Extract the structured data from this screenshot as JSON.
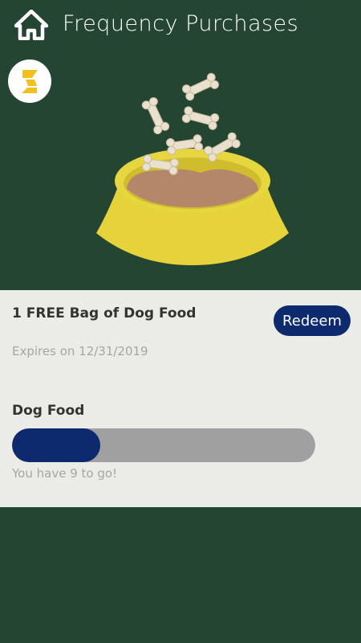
{
  "header": {
    "title": "Frequency Purchases",
    "home_icon": "home-icon"
  },
  "brand": {
    "logo_icon": "brand-logo-icon"
  },
  "hero": {
    "illustration": "dog-bowl-with-bones"
  },
  "reward": {
    "title": "1 FREE Bag of Dog Food",
    "redeem_label": "Redeem",
    "expires": "Expires on 12/31/2019"
  },
  "progress": {
    "label": "Dog Food",
    "fraction": 0.29,
    "status_text": "You have 9 to go!"
  },
  "colors": {
    "background": "#254533",
    "accent": "#0e2a6e",
    "card": "#ebebe7",
    "bowl": "#e8d43a",
    "brand_yellow": "#f0c020"
  }
}
